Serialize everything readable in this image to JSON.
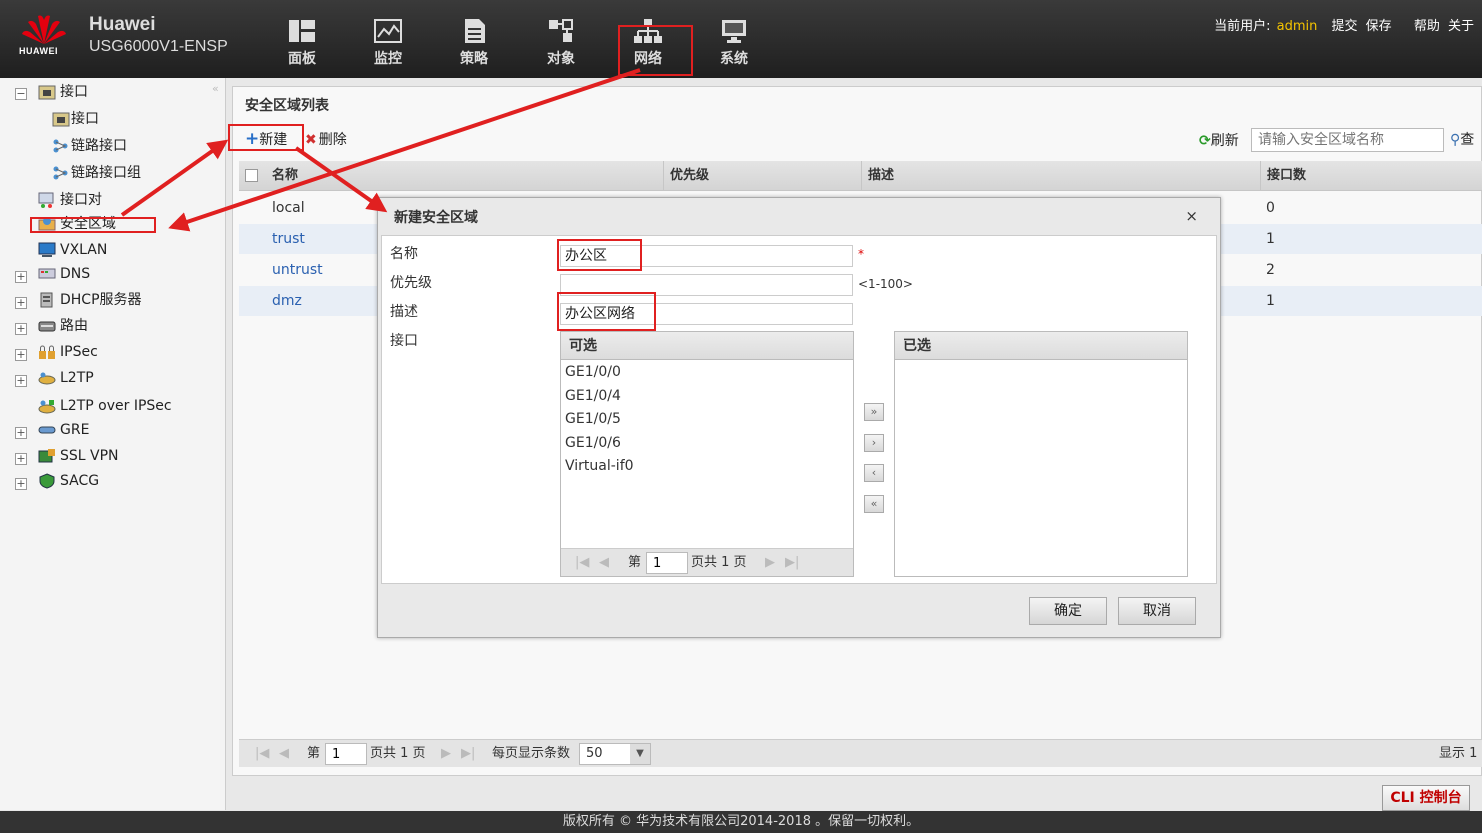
{
  "header": {
    "logo_text": "HUAWEI",
    "brand": "Huawei",
    "model": "USG6000V1-ENSP",
    "nav": [
      "面板",
      "监控",
      "策略",
      "对象",
      "网络",
      "系统"
    ],
    "current_user_label": "当前用户:",
    "username": "admin",
    "links": [
      "提交",
      "保存",
      "帮助",
      "关于"
    ]
  },
  "sidebar": {
    "collapse": "«",
    "items": [
      {
        "label": "接口",
        "toggle": "−"
      },
      {
        "label": "接口"
      },
      {
        "label": "链路接口"
      },
      {
        "label": "链路接口组"
      },
      {
        "label": "接口对"
      },
      {
        "label": "安全区域"
      },
      {
        "label": "VXLAN"
      },
      {
        "label": "DNS",
        "toggle": "+"
      },
      {
        "label": "DHCP服务器",
        "toggle": "+"
      },
      {
        "label": "路由",
        "toggle": "+"
      },
      {
        "label": "IPSec",
        "toggle": "+"
      },
      {
        "label": "L2TP",
        "toggle": "+"
      },
      {
        "label": "L2TP over IPSec"
      },
      {
        "label": "GRE",
        "toggle": "+"
      },
      {
        "label": "SSL VPN",
        "toggle": "+"
      },
      {
        "label": "SACG",
        "toggle": "+"
      }
    ]
  },
  "main": {
    "title": "安全区域列表",
    "toolbar": {
      "new": "新建",
      "delete": "删除",
      "refresh": "刷新"
    },
    "search_placeholder": "请输入安全区域名称",
    "columns": [
      "名称",
      "优先级",
      "描述",
      "接口数"
    ],
    "rows": [
      {
        "name": "local",
        "count": "0"
      },
      {
        "name": "trust",
        "count": "1"
      },
      {
        "name": "untrust",
        "count": "2"
      },
      {
        "name": "dmz",
        "count": "1"
      }
    ],
    "pager": {
      "page_prefix": "第",
      "page": "1",
      "page_suffix": "页共 1 页",
      "per_page_label": "每页显示条数",
      "per_page": "50",
      "display": "显示 1"
    }
  },
  "dialog": {
    "title": "新建安全区域",
    "close": "×",
    "labels": {
      "name": "名称",
      "priority": "优先级",
      "desc": "描述",
      "iface": "接口"
    },
    "name_value": "办公区",
    "required_mark": "*",
    "priority_value": "",
    "priority_hint": "<1-100>",
    "desc_value": "办公区网络",
    "available_header": "可选",
    "selected_header": "已选",
    "available": [
      "GE1/0/0",
      "GE1/0/4",
      "GE1/0/5",
      "GE1/0/6",
      "Virtual-if0"
    ],
    "move_buttons": [
      "»",
      "›",
      "‹",
      "«"
    ],
    "list_pager": {
      "prefix": "第",
      "page": "1",
      "suffix": "页共 1 页"
    },
    "ok": "确定",
    "cancel": "取消"
  },
  "cli_button": "CLI 控制台",
  "footer": "版权所有 © 华为技术有限公司2014-2018 。保留一切权利。",
  "colors": {
    "annotation_red": "#e02020",
    "link_blue": "#2a60b0",
    "username_yellow": "#f5c400"
  }
}
